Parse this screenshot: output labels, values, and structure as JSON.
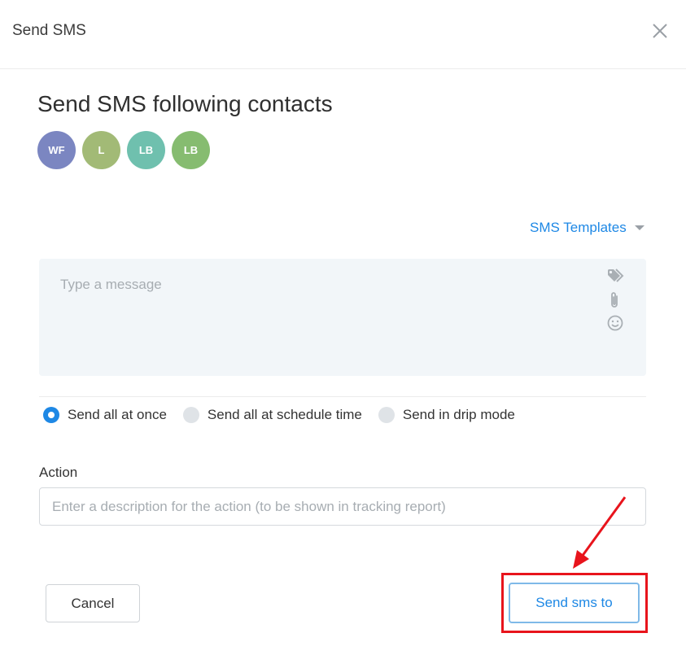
{
  "header": {
    "title": "Send SMS"
  },
  "heading": "Send SMS following contacts",
  "contacts": [
    {
      "initials": "WF",
      "color": "#7b86c1"
    },
    {
      "initials": "L",
      "color": "#a2ba76"
    },
    {
      "initials": "LB",
      "color": "#6fc0ae"
    },
    {
      "initials": "LB",
      "color": "#86bc70"
    }
  ],
  "templates": {
    "label": "SMS Templates"
  },
  "message": {
    "placeholder": "Type a message",
    "value": ""
  },
  "message_tools": [
    "tag-icon",
    "paperclip-icon",
    "smiley-icon"
  ],
  "send_modes": [
    {
      "label": "Send all at once",
      "checked": true
    },
    {
      "label": "Send all at schedule time",
      "checked": false
    },
    {
      "label": "Send in drip mode",
      "checked": false
    }
  ],
  "action": {
    "label": "Action",
    "placeholder": "Enter a description for the action (to be shown in tracking report)",
    "value": ""
  },
  "buttons": {
    "cancel": "Cancel",
    "send": "Send sms to"
  },
  "colors": {
    "accent": "#1e88e5",
    "annotation": "#e8141c"
  }
}
